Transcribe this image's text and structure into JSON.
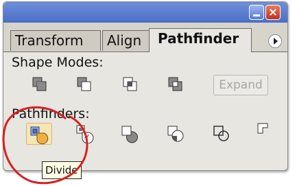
{
  "window": {
    "minimize_icon": "minimize-icon",
    "close_glyph": "×"
  },
  "tabs": [
    {
      "label": "Transform",
      "active": false
    },
    {
      "label": "Align",
      "active": false
    },
    {
      "label": "Pathfinder",
      "active": true
    }
  ],
  "shape_modes": {
    "label": "Shape Modes:",
    "buttons": [
      "add-to-shape-area-icon",
      "subtract-from-shape-area-icon",
      "intersect-shape-areas-icon",
      "exclude-overlapping-shape-areas-icon"
    ],
    "expand_label": "Expand",
    "expand_enabled": false
  },
  "pathfinders": {
    "label": "Pathfinders:",
    "buttons": [
      "divide-icon",
      "trim-icon",
      "merge-icon",
      "crop-icon",
      "outline-icon",
      "minus-back-icon"
    ],
    "active": "divide-icon"
  },
  "tooltip": {
    "text": "Divide"
  },
  "colors": {
    "title_bar": "#4a6fc8",
    "close_button": "#d8452a",
    "panel_bg": "#e8e6e1",
    "highlight_circle": "#d82020",
    "active_button_bg": "#f5e6b8"
  }
}
